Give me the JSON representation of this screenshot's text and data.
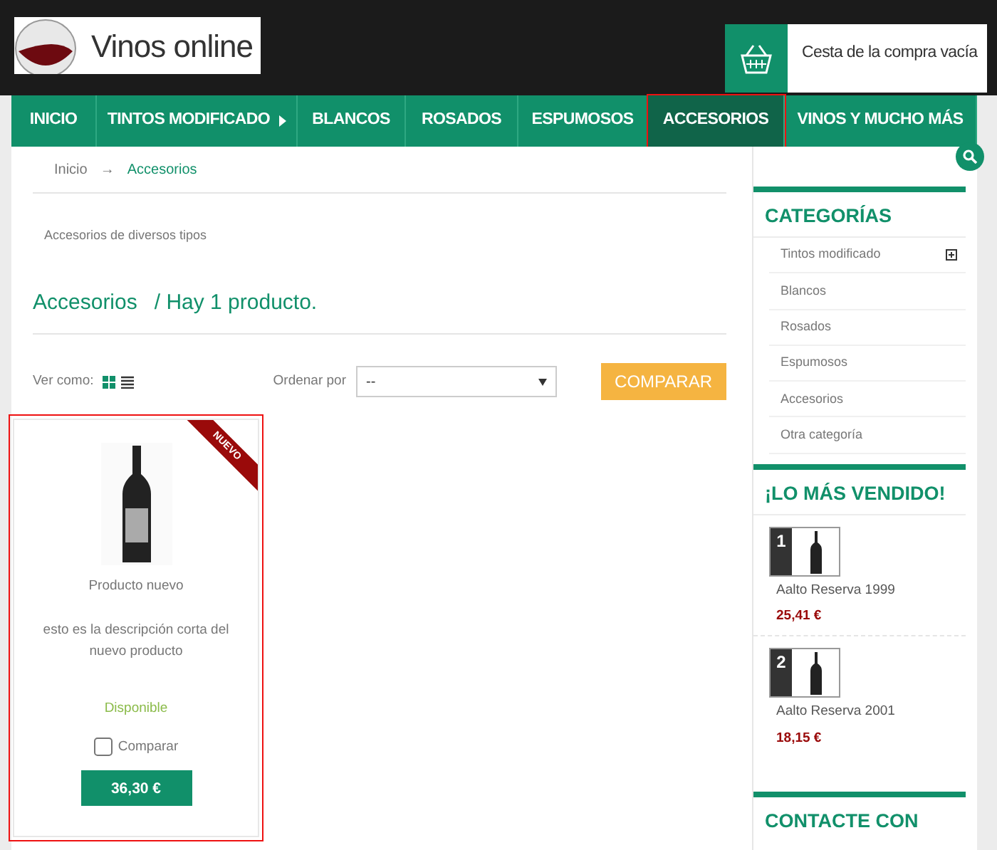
{
  "header": {
    "logo_text": "Vinos online",
    "cart": {
      "label": "Cesta de la compra vacía"
    }
  },
  "nav": [
    {
      "label": "INICIO",
      "selected": false,
      "has_submenu": false,
      "highlighted": false
    },
    {
      "label": "TINTOS MODIFICADO",
      "selected": false,
      "has_submenu": true,
      "highlighted": false
    },
    {
      "label": "BLANCOS",
      "selected": false,
      "has_submenu": false,
      "highlighted": false
    },
    {
      "label": "ROSADOS",
      "selected": false,
      "has_submenu": false,
      "highlighted": false
    },
    {
      "label": "ESPUMOSOS",
      "selected": false,
      "has_submenu": false,
      "highlighted": false
    },
    {
      "label": "ACCESORIOS",
      "selected": true,
      "has_submenu": false,
      "highlighted": true
    },
    {
      "label": "VINOS Y MUCHO MÁS",
      "selected": false,
      "has_submenu": false,
      "highlighted": false
    }
  ],
  "breadcrumb": [
    {
      "label": "Inicio",
      "current": false
    },
    {
      "label": "Accesorios",
      "current": true
    }
  ],
  "breadcrumb_separator": "→",
  "category_description": "Accesorios de diversos tipos",
  "heading": {
    "category": "Accesorios",
    "count": "/ Hay 1 producto."
  },
  "toolbar": {
    "view_label": "Ver como:",
    "views": [
      {
        "kind": "grid",
        "selected": true
      },
      {
        "kind": "list",
        "selected": false
      }
    ],
    "sort_label": "Ordenar por",
    "sort_value": "--",
    "compare_button": "COMPARAR"
  },
  "products": [
    {
      "ribbon": "NUEVO",
      "name": "Producto nuevo",
      "description": "esto es la descripción corta del nuevo producto",
      "availability": "Disponible",
      "compare": {
        "label": "Comparar",
        "checked": false
      },
      "price": "36,30 €",
      "highlighted": true
    }
  ],
  "sidebar": {
    "categories": {
      "title": "CATEGORÍAS",
      "items": [
        {
          "label": "Tintos modificado",
          "expandable": true
        },
        {
          "label": "Blancos",
          "expandable": false
        },
        {
          "label": "Rosados",
          "expandable": false
        },
        {
          "label": "Espumosos",
          "expandable": false
        },
        {
          "label": "Accesorios",
          "expandable": false
        },
        {
          "label": "Otra categoría",
          "expandable": false
        }
      ]
    },
    "bestsellers": {
      "title": "¡LO MÁS VENDIDO!",
      "items": [
        {
          "rank": "1",
          "name": "Aalto Reserva 1999",
          "price": "25,41 €"
        },
        {
          "rank": "2",
          "name": "Aalto Reserva 2001",
          "price": "18,15 €"
        }
      ]
    },
    "contact": {
      "title": "CONTACTE CON"
    }
  }
}
